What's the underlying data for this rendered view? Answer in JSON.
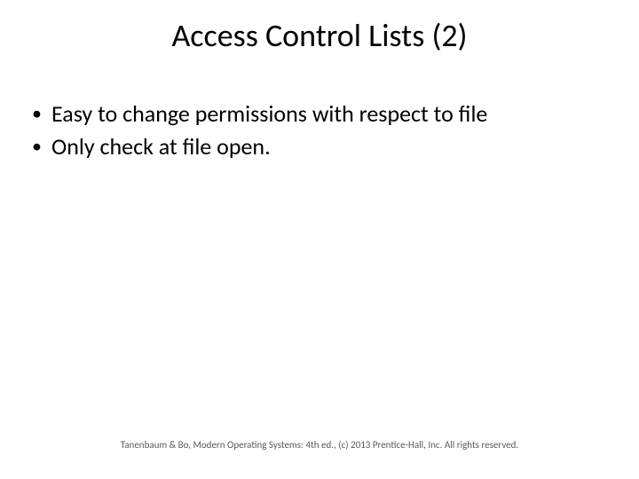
{
  "title": "Access Control Lists (2)",
  "bullets": [
    "Easy to change permissions with respect to file",
    "Only check at file open."
  ],
  "footer": "Tanenbaum & Bo, Modern Operating Systems: 4th ed., (c) 2013 Prentice-Hall, Inc. All rights reserved."
}
